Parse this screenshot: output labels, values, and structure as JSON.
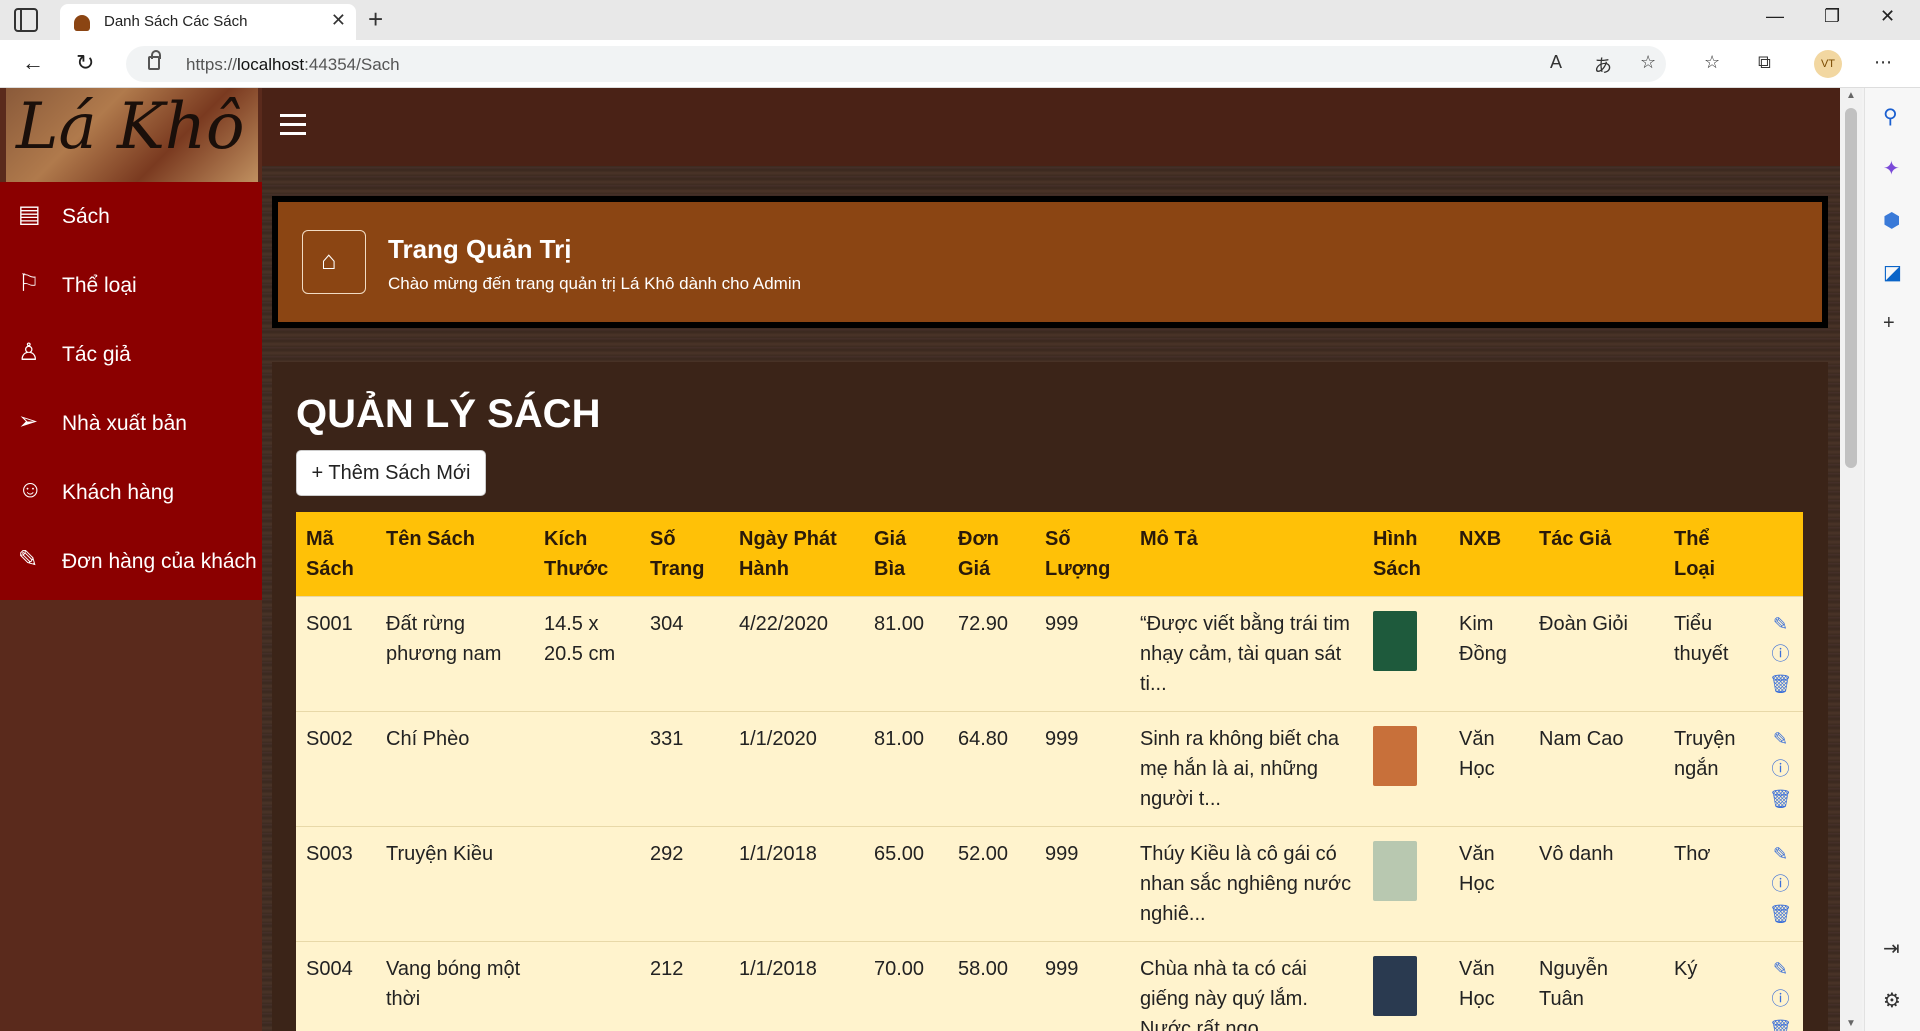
{
  "browser": {
    "tab_title": "Danh Sách Các Sách",
    "url_prefix": "https://",
    "url_host": "localhost",
    "url_rest": ":44354/Sach",
    "profile_initials": "VT"
  },
  "sidebar": {
    "logo_text": "Lá Khô",
    "items": [
      {
        "label": "Sách",
        "icon": "book-icon"
      },
      {
        "label": "Thể loại",
        "icon": "flag-icon"
      },
      {
        "label": "Tác giả",
        "icon": "person-icon"
      },
      {
        "label": "Nhà xuất bản",
        "icon": "send-icon"
      },
      {
        "label": "Khách hàng",
        "icon": "people-icon"
      },
      {
        "label": "Đơn hàng của khách",
        "icon": "ticket-icon"
      }
    ]
  },
  "banner": {
    "title": "Trang Quản Trị",
    "subtitle": "Chào mừng đến trang quản trị Lá Khô dành cho Admin"
  },
  "main": {
    "title": "QUẢN LÝ SÁCH",
    "add_button": "+ Thêm Sách Mới"
  },
  "table": {
    "headers": [
      "Mã Sách",
      "Tên Sách",
      "Kích Thước",
      "Số Trang",
      "Ngày Phát Hành",
      "Giá Bìa",
      "Đơn Giá",
      "Số Lượng",
      "Mô Tả",
      "Hình Sách",
      "NXB",
      "Tác Giả",
      "Thể Loại",
      ""
    ],
    "rows": [
      {
        "ma": "S001",
        "ten": "Đất rừng phương nam",
        "kich_thuoc": "14.5 x 20.5 cm",
        "so_trang": "304",
        "ngay": "4/22/2020",
        "gia_bia": "81.00",
        "don_gia": "72.90",
        "so_luong": "999",
        "mo_ta": "“Được viết bằng trái tim nhạy cảm, tài quan sát ti...",
        "nxb": "Kim Đồng",
        "tac_gia": "Đoàn Giỏi",
        "the_loai": "Tiểu thuyết",
        "cover_color": "#1e5a3c"
      },
      {
        "ma": "S002",
        "ten": "Chí Phèo",
        "kich_thuoc": "",
        "so_trang": "331",
        "ngay": "1/1/2020",
        "gia_bia": "81.00",
        "don_gia": "64.80",
        "so_luong": "999",
        "mo_ta": "Sinh ra không biết cha mẹ hắn là ai, những người t...",
        "nxb": "Văn Học",
        "tac_gia": "Nam Cao",
        "the_loai": "Truyện ngắn",
        "cover_color": "#c8703a"
      },
      {
        "ma": "S003",
        "ten": "Truyện Kiều",
        "kich_thuoc": "",
        "so_trang": "292",
        "ngay": "1/1/2018",
        "gia_bia": "65.00",
        "don_gia": "52.00",
        "so_luong": "999",
        "mo_ta": "Thúy Kiều là cô gái có nhan sắc nghiêng nước nghiê...",
        "nxb": "Văn Học",
        "tac_gia": "Vô danh",
        "the_loai": "Thơ",
        "cover_color": "#b8c8b0"
      },
      {
        "ma": "S004",
        "ten": "Vang bóng một thời",
        "kich_thuoc": "",
        "so_trang": "212",
        "ngay": "1/1/2018",
        "gia_bia": "70.00",
        "don_gia": "58.00",
        "so_luong": "999",
        "mo_ta": "Chùa nhà ta có cái giếng này quý lắm. Nước rất ngọ...",
        "nxb": "Văn Học",
        "tac_gia": "Nguyễn Tuân",
        "the_loai": "Ký",
        "cover_color": "#2a3a50"
      }
    ]
  },
  "colors": {
    "menu_bg": "#8b0000",
    "banner_bg": "#8b4513",
    "table_header": "#ffc107",
    "table_row": "#fff3cd",
    "action_icon": "#3b6fd8"
  }
}
